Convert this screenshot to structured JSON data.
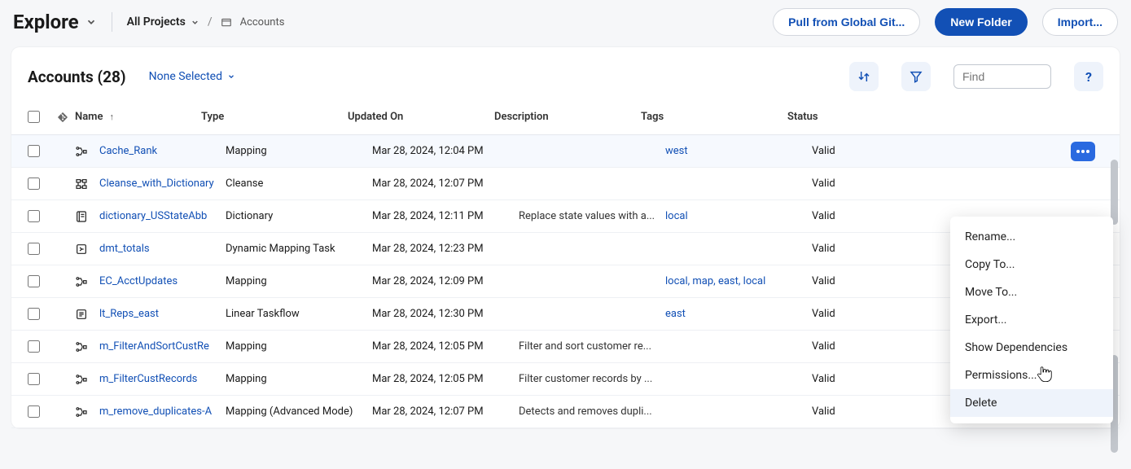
{
  "topbar": {
    "brand": "Explore",
    "projects_label": "All Projects",
    "breadcrumb_leaf": "Accounts",
    "pull_btn": "Pull from Global Git...",
    "new_folder_btn": "New Folder",
    "import_btn": "Import..."
  },
  "panel": {
    "title": "Accounts (28)",
    "none_selected": "None Selected",
    "find_placeholder": "Find",
    "help": "?"
  },
  "columns": {
    "name": "Name",
    "type": "Type",
    "updated": "Updated On",
    "desc": "Description",
    "tags": "Tags",
    "status": "Status"
  },
  "rows": [
    {
      "icon": "mapping",
      "name": "Cache_Rank",
      "type": "Mapping",
      "updated": "Mar 28, 2024, 12:04 PM",
      "desc": "",
      "tags": "west",
      "status": "Valid",
      "active": true
    },
    {
      "icon": "cleanse",
      "name": "Cleanse_with_Dictionary",
      "type": "Cleanse",
      "updated": "Mar 28, 2024, 12:07 PM",
      "desc": "",
      "tags": "",
      "status": "Valid"
    },
    {
      "icon": "dictionary",
      "name": "dictionary_USStateAbb",
      "type": "Dictionary",
      "updated": "Mar 28, 2024, 12:11 PM",
      "desc": "Replace state values with a...",
      "tags": "local",
      "status": "Valid"
    },
    {
      "icon": "dmt",
      "name": "dmt_totals",
      "type": "Dynamic Mapping Task",
      "updated": "Mar 28, 2024, 12:23 PM",
      "desc": "",
      "tags": "",
      "status": "Valid"
    },
    {
      "icon": "mapping",
      "name": "EC_AcctUpdates",
      "type": "Mapping",
      "updated": "Mar 28, 2024, 12:09 PM",
      "desc": "",
      "tags": "local, map, east, local",
      "status": "Valid"
    },
    {
      "icon": "taskflow",
      "name": "lt_Reps_east",
      "type": "Linear Taskflow",
      "updated": "Mar 28, 2024, 12:30 PM",
      "desc": "",
      "tags": "east",
      "status": "Valid"
    },
    {
      "icon": "mapping",
      "name": "m_FilterAndSortCustRe",
      "type": "Mapping",
      "updated": "Mar 28, 2024, 12:05 PM",
      "desc": "Filter and sort customer re...",
      "tags": "",
      "status": "Valid"
    },
    {
      "icon": "mapping",
      "name": "m_FilterCustRecords",
      "type": "Mapping",
      "updated": "Mar 28, 2024, 12:05 PM",
      "desc": "Filter customer records by ...",
      "tags": "",
      "status": "Valid"
    },
    {
      "icon": "mapping",
      "name": "m_remove_duplicates-A",
      "type": "Mapping (Advanced Mode)",
      "updated": "Mar 28, 2024, 12:07 PM",
      "desc": "Detects and removes dupli...",
      "tags": "",
      "status": "Valid"
    }
  ],
  "context_menu": {
    "rename": "Rename...",
    "copy": "Copy To...",
    "move": "Move To...",
    "export": "Export...",
    "deps": "Show Dependencies",
    "perms": "Permissions...",
    "delete": "Delete"
  }
}
